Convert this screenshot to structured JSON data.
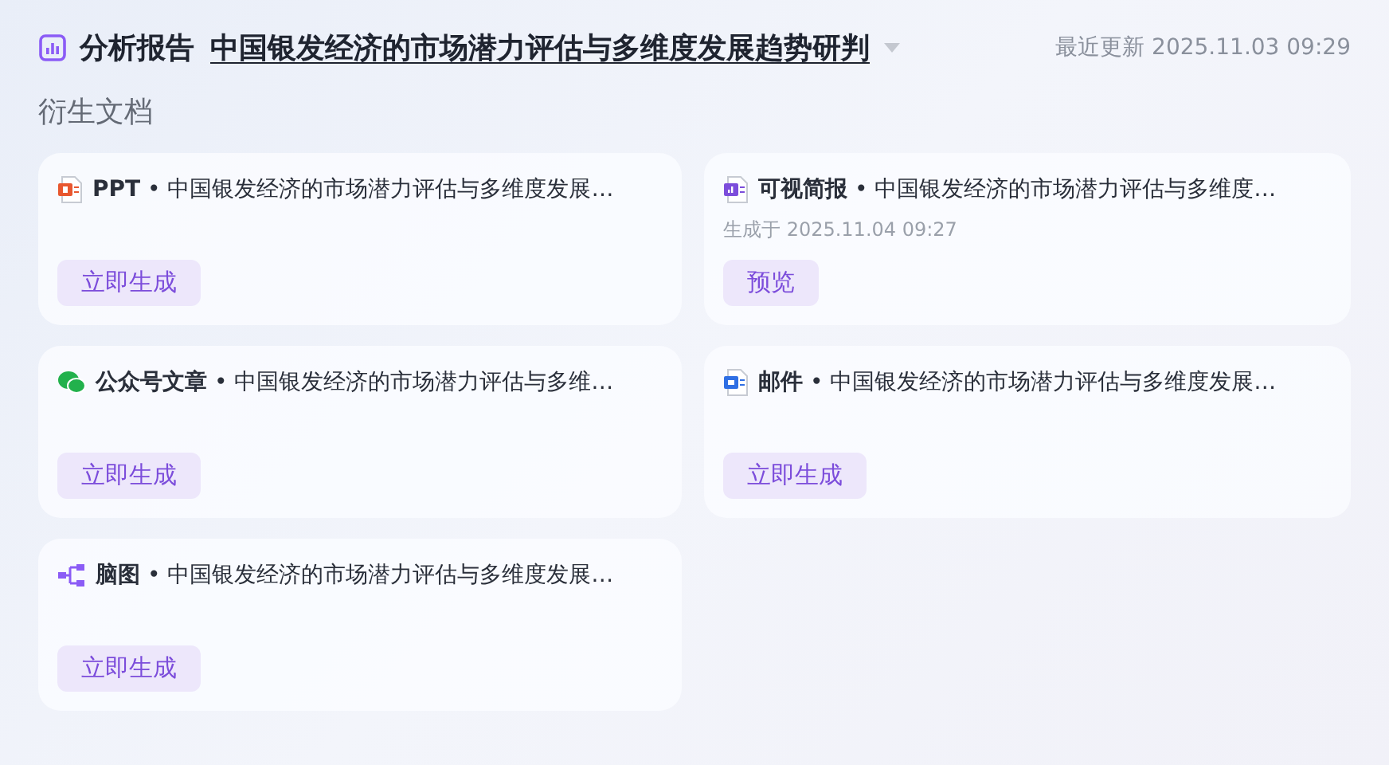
{
  "header": {
    "section": "分析报告",
    "report_title": "中国银发经济的市场潜力评估与多维度发展趋势研判",
    "updated": "最近更新 2025.11.03 09:29"
  },
  "subtitle": "衍生文档",
  "documents": [
    {
      "kind": "ppt",
      "title": "**PPT** • 中国银发经济的市场潜力评估与多维度发展…",
      "button": "立即生成"
    },
    {
      "kind": "visual",
      "title": "**可视简报** • 中国银发经济的市场潜力评估与多维度…",
      "generated": "生成于 2025.11.04 09:27",
      "button": "预览"
    },
    {
      "kind": "wechat",
      "title": "**公众号文章** • 中国银发经济的市场潜力评估与多维…",
      "button": "立即生成"
    },
    {
      "kind": "email",
      "title": "**邮件** • 中国银发经济的市场潜力评估与多维度发展…",
      "button": "立即生成"
    },
    {
      "kind": "mindmap",
      "title": "**脑图** • 中国银发经济的市场潜力评估与多维度发展…",
      "button": "立即生成"
    }
  ]
}
